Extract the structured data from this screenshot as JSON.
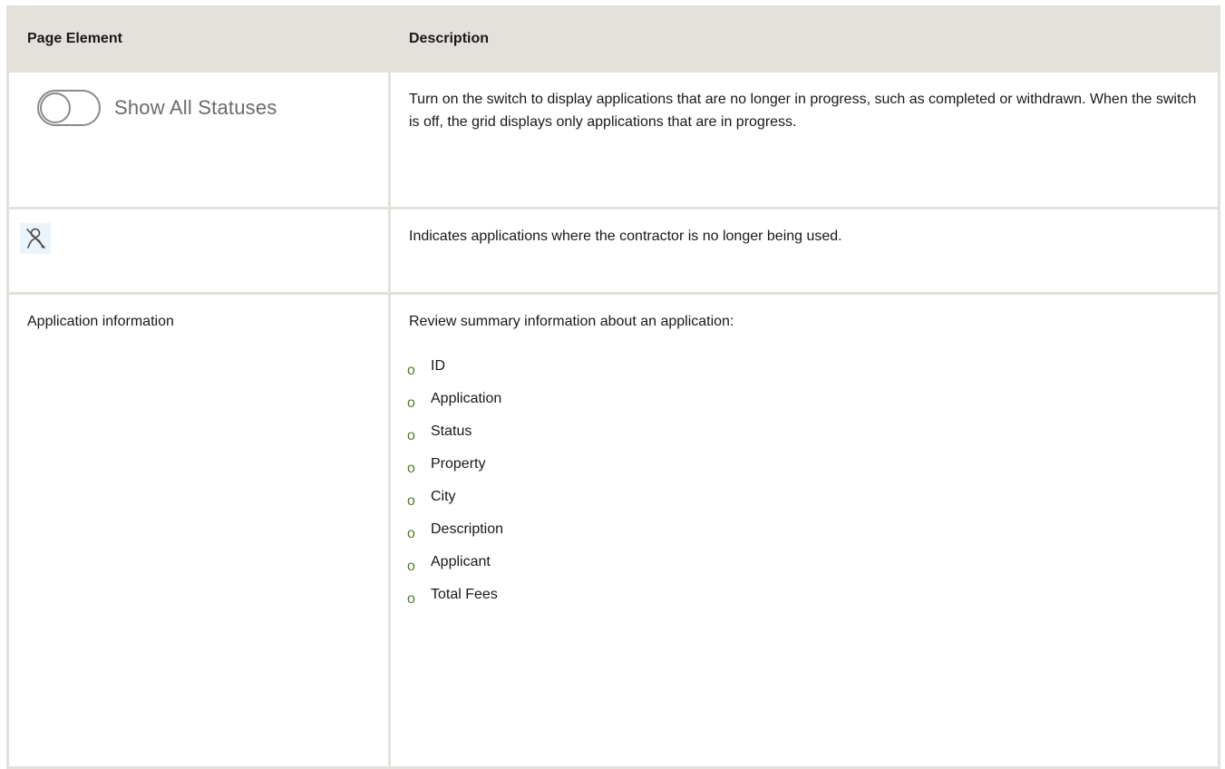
{
  "table": {
    "headers": [
      "Page Element",
      "Description"
    ],
    "rows": [
      {
        "element": {
          "toggle_state": "off",
          "toggle_label": "Show All Statuses"
        },
        "description": "Turn on the switch to display applications that are no longer in progress, such as completed or withdrawn. When the switch is off, the grid displays only applications that are in progress."
      },
      {
        "element": {
          "icon": "contractor-not-used-icon"
        },
        "description": "Indicates applications where the contractor is no longer being used."
      },
      {
        "element": {
          "text": "Application information"
        },
        "description": "Review summary information about an application:",
        "bullet_marker": "o",
        "bullets": [
          "ID",
          "Application",
          "Status",
          "Property",
          "City",
          "Description",
          "Applicant",
          "Total Fees"
        ]
      }
    ]
  },
  "colors": {
    "header_bg": "#e4e1dc",
    "border": "#e4e1dc",
    "bullet": "#4f7a28",
    "icon_bg": "#eaf4fa"
  }
}
